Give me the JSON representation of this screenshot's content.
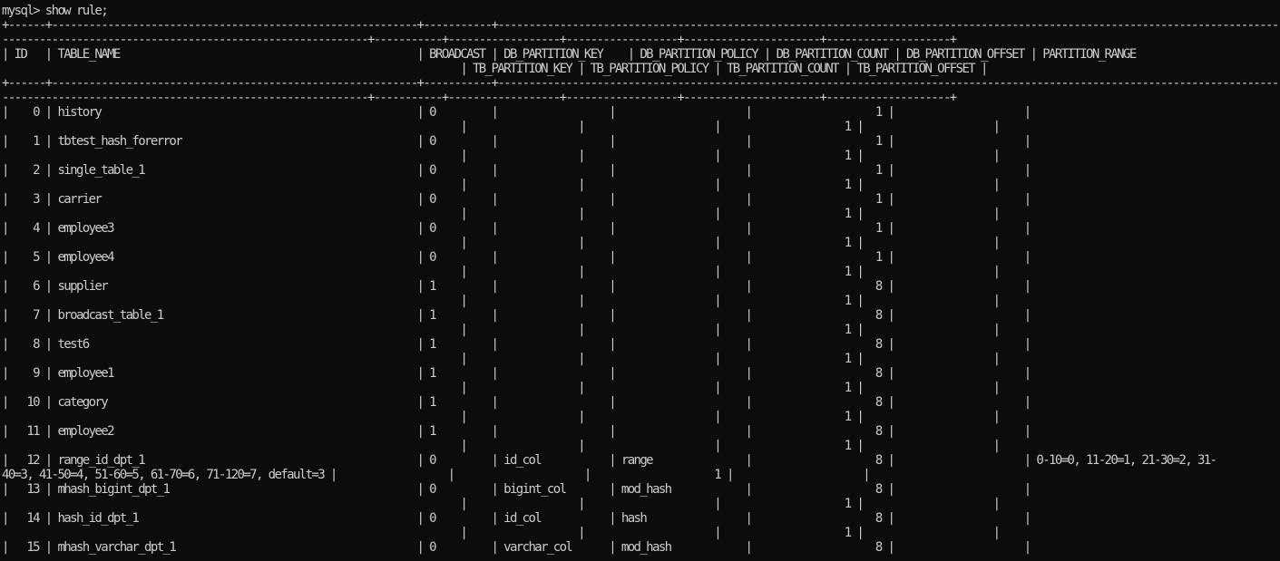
{
  "terminal": {
    "colors": {
      "background": "#0c0c0c",
      "foreground": "#cccccc"
    },
    "lines": [
      "mysql> show rule;",
      "+------+-----------------------------------------------------------+-----------+---------------------------------------------------------------------------------------------------------------------------------------------------------------------------------+",
      "-----------------------------------------------------------+-----------+------------------+------------------+----------------------+--------------------+",
      "| ID   | TABLE_NAME                                                | BROADCAST | DB_PARTITION_KEY    | DB_PARTITION_POLICY | DB_PARTITION_COUNT | DB_PARTITION_OFFSET | PARTITION_RANGE",
      "                                                                          | TB_PARTITION_KEY | TB_PARTITION_POLICY | TB_PARTITION_COUNT | TB_PARTITION_OFFSET |",
      "+------+-----------------------------------------------------------+-----------+---------------------------------------------------------------------------------------------------------------------------------------------------------------------------------+",
      "-----------------------------------------------------------+-----------+------------------+------------------+----------------------+--------------------+",
      "|    0 | history                                                   | 0         |                  |                     |                    1 |                     |",
      "                                                                          |                  |                     |                    1 |                     |",
      "|    1 | tbtest_hash_forerror                                      | 0         |                  |                     |                    1 |                     |",
      "                                                                          |                  |                     |                    1 |                     |",
      "|    2 | single_table_1                                            | 0         |                  |                     |                    1 |                     |",
      "                                                                          |                  |                     |                    1 |                     |",
      "|    3 | carrier                                                   | 0         |                  |                     |                    1 |                     |",
      "                                                                          |                  |                     |                    1 |                     |",
      "|    4 | employee3                                                 | 0         |                  |                     |                    1 |                     |",
      "                                                                          |                  |                     |                    1 |                     |",
      "|    5 | employee4                                                 | 0         |                  |                     |                    1 |                     |",
      "                                                                          |                  |                     |                    1 |                     |",
      "|    6 | supplier                                                  | 1         |                  |                     |                    8 |                     |",
      "                                                                          |                  |                     |                    1 |                     |",
      "|    7 | broadcast_table_1                                         | 1         |                  |                     |                    8 |                     |",
      "                                                                          |                  |                     |                    1 |                     |",
      "|    8 | test6                                                     | 1         |                  |                     |                    8 |                     |",
      "                                                                          |                  |                     |                    1 |                     |",
      "|    9 | employee1                                                 | 1         |                  |                     |                    8 |                     |",
      "                                                                          |                  |                     |                    1 |                     |",
      "|   10 | category                                                  | 1         |                  |                     |                    8 |                     |",
      "                                                                          |                  |                     |                    1 |                     |",
      "|   11 | employee2                                                 | 1         |                  |                     |                    8 |                     |",
      "                                                                          |                  |                     |                    1 |                     |",
      "|   12 | range_id_dpt_1                                            | 0         | id_col           | range               |                    8 |                     | 0-10=0, 11-20=1, 21-30=2, 31-",
      "40=3, 41-50=4, 51-60=5, 61-70=6, 71-120=7, default=3 |                  |                     |                    1 |                     |",
      "|   13 | mhash_bigint_dpt_1                                        | 0         | bigint_col       | mod_hash            |                    8 |                     |",
      "                                                                          |                  |                     |                    1 |                     |",
      "|   14 | hash_id_dpt_1                                             | 0         | id_col           | hash                |                    8 |                     |",
      "                                                                          |                  |                     |                    1 |                     |",
      "|   15 | mhash_varchar_dpt_1                                       | 0         | varchar_col      | mod_hash            |                    8 |                     |"
    ]
  }
}
